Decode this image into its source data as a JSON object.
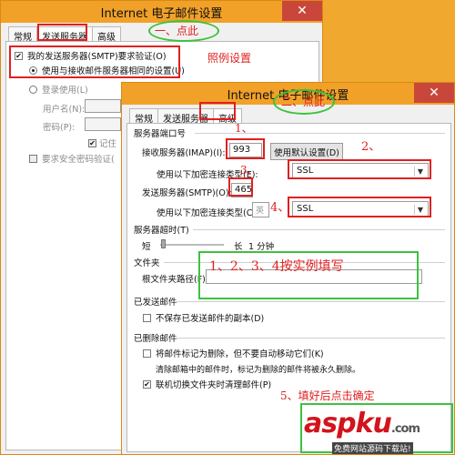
{
  "back_window": {
    "title": "Internet 电子邮件设置",
    "close": "✕",
    "tabs": [
      "常规",
      "发送服务器",
      "高级"
    ],
    "smtp_auth": "我的发送服务器(SMTP)要求验证(O)",
    "same_settings": "使用与接收邮件服务器相同的设置(U)",
    "login_using": "登录使用(L)",
    "username": "用户名(N):",
    "password": "密码(P):",
    "remember": "记住",
    "spa": "要求安全密码验证("
  },
  "front_window": {
    "title": "Internet 电子邮件设置",
    "close": "✕",
    "tabs": [
      "常规",
      "发送服务器",
      "高级"
    ],
    "server_ports": "服务器端口号",
    "imap_label": "接收服务器(IMAP)(I):",
    "imap_value": "993",
    "default_button": "使用默认设置(D)",
    "encryption_label_1": "使用以下加密连接类型(E):",
    "encryption_value_1": "SSL",
    "smtp_label": "发送服务器(SMTP)(O):",
    "smtp_value": "465",
    "encryption_label_2": "使用以下加密连接类型(C):",
    "encryption_value_2": "SSL",
    "ime_glyph": "英",
    "timeouts": "服务器超时(T)",
    "short": "短",
    "long": "长",
    "timeout_value": "1 分钟",
    "folders": "文件夹",
    "root_folder": "根文件夹路径(F):",
    "sent_items": "已发送邮件",
    "no_save_sent": "不保存已发送邮件的副本(D)",
    "deleted_items": "已删除邮件",
    "mark_delete": "将邮件标记为删除，但不要自动移动它们(K)",
    "purge_note": "清除邮箱中的邮件时，标记为删除的邮件将被永久删除。",
    "purge_on_switch": "联机切换文件夹时清理邮件(P)"
  },
  "annotations": {
    "a1_click": "一、点此",
    "example": "照例设置",
    "a2_click": "二、点此",
    "n1": "1、",
    "n2": "2、",
    "n3": "3、",
    "n4": "4、",
    "fill": "1、2、3、4按实例填写",
    "confirm": "5、填好后点击确定"
  },
  "watermark": {
    "logo": "aspku",
    "suffix": ".com",
    "tagline": "免费网站源码下载站!"
  },
  "colors": {
    "annotation_red": "#e02020",
    "annotation_green": "#3dc23d",
    "titlebar": "#f2a128"
  }
}
